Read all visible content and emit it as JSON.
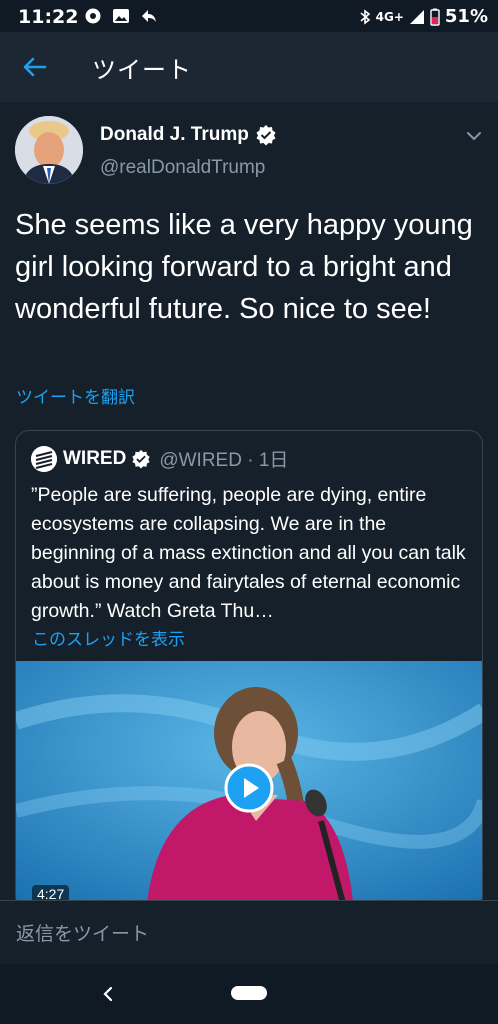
{
  "status_bar": {
    "time": "11:22",
    "network": "4G+",
    "battery": "51%",
    "icons": [
      "circle-status-icon",
      "image-notification-icon",
      "reply-notification-icon",
      "bluetooth-icon",
      "signal-icon",
      "battery-icon"
    ]
  },
  "header": {
    "title": "ツイート",
    "back_icon": "arrow-left-icon"
  },
  "tweet": {
    "author_name": "Donald J. Trump",
    "author_handle": "@realDonaldTrump",
    "verified": true,
    "text": "She seems like a very happy young girl looking forward to a bright and wonderful future. So nice to see!",
    "translate_label": "ツイートを翻訳"
  },
  "quoted_tweet": {
    "author_name": "WIRED",
    "author_handle": "@WIRED · 1日",
    "verified": true,
    "text": "”People are suffering, people are dying, entire ecosystems are collapsing. We are in the beginning of a mass extinction and all you can talk about is money and fairytales of eternal economic growth.” Watch Greta Thu…",
    "thread_label": "このスレッドを表示",
    "video_duration": "4:27"
  },
  "reply": {
    "placeholder": "返信をツイート"
  },
  "colors": {
    "background": "#15202b",
    "header": "#1c2733",
    "accent": "#1da1f2",
    "secondary_text": "#8899a6",
    "border": "#38444d"
  }
}
